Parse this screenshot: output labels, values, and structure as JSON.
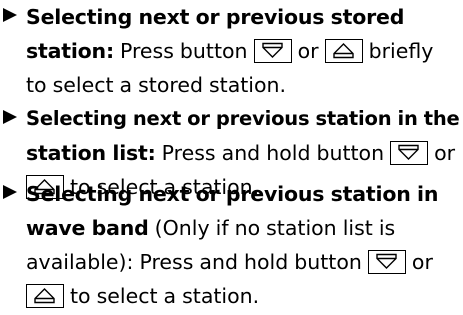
{
  "instructions": [
    {
      "icon": "triangle-bullet-icon",
      "lines": [
        {
          "bold": "Selecting next or previous stored"
        },
        {
          "bold": "station:",
          "t1": " Press button ",
          "k1": "down-arrow-icon",
          "t2": " or ",
          "k2": "up-arrow-icon",
          "t3": " briefly"
        },
        {
          "t1": "to select a stored station."
        }
      ]
    },
    {
      "icon": "triangle-bullet-icon",
      "lines": [
        {
          "bold": "Selecting next or previous station in the"
        },
        {
          "bold": "station list:",
          "t1": " Press and hold button ",
          "k1": "down-arrow-icon",
          "t2": " or"
        },
        {
          "k1": "up-arrow-icon",
          "t1": " to select a station."
        }
      ]
    },
    {
      "icon": "triangle-bullet-icon",
      "lines": [
        {
          "bold": "Selecting next or previous station in"
        },
        {
          "bold": "wave band",
          "t1": " (Only if no station list is"
        },
        {
          "t1": "available): Press and hold button ",
          "k1": "down-arrow-icon",
          "t2": " or"
        },
        {
          "k1": "up-arrow-icon",
          "t1": " to select a station."
        }
      ]
    }
  ]
}
